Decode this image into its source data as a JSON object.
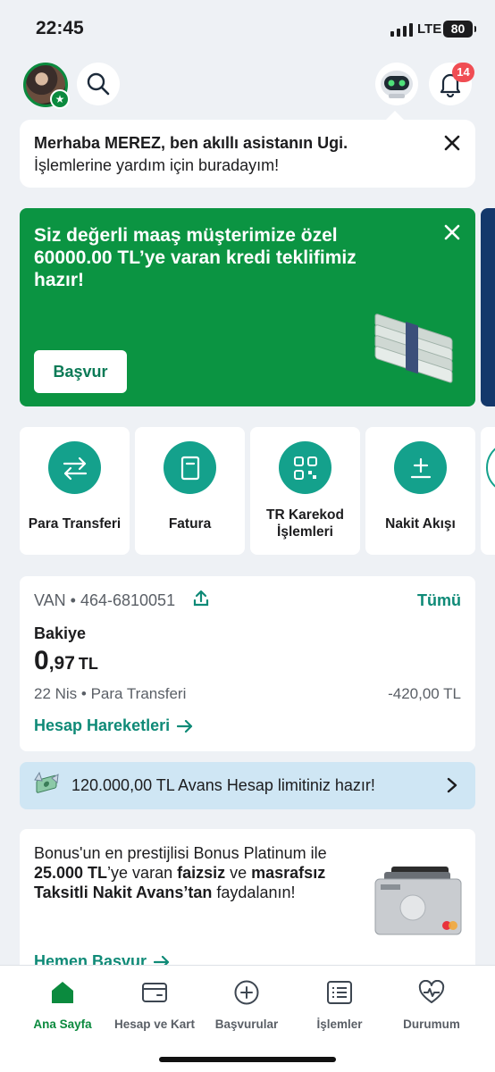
{
  "status_bar": {
    "time": "22:45",
    "network": "LTE",
    "battery": "80"
  },
  "header": {
    "notification_count": "14"
  },
  "assistant": {
    "line1": "Merhaba MEREZ, ben akıllı asistanın Ugi.",
    "line2": "İşlemlerine yardım için buradayım!"
  },
  "promo": {
    "title": "Siz değerli maaş müşterimize özel 60000.00 TL’ye varan kredi teklifimiz hazır!",
    "button": "Başvur"
  },
  "quick_actions": [
    {
      "label": "Para Transferi",
      "icon": "transfer-arrows-icon"
    },
    {
      "label": "Fatura",
      "icon": "bill-icon"
    },
    {
      "label": "TR Karekod İşlemleri",
      "icon": "qr-code-icon"
    },
    {
      "label": "Nakit Akışı",
      "icon": "cash-flow-icon"
    }
  ],
  "account": {
    "number": "VAN • 464-6810051",
    "all_link": "Tümü",
    "balance_label": "Bakiye",
    "balance_int": "0",
    "balance_dec": ",97",
    "balance_currency": "TL",
    "last_tx": "22 Nis • Para Transferi",
    "last_amount": "-420,00 TL",
    "movements_link": "Hesap Hareketleri"
  },
  "avans": {
    "text": "120.000,00 TL Avans Hesap limitiniz hazır!"
  },
  "bonus": {
    "t1": "Bonus'un en prestijlisi Bonus Platinum ile ",
    "t2": "25.000 TL",
    "t3": "’ye varan ",
    "t4": "faizsiz",
    "t5": " ve ",
    "t6": "masrafsız Taksitli Nakit Avans’tan",
    "t7": " faydalanın!",
    "apply_link": "Hemen Başvur"
  },
  "nav": [
    {
      "label": "Ana Sayfa",
      "active": true
    },
    {
      "label": "Hesap ve Kart"
    },
    {
      "label": "Başvurular"
    },
    {
      "label": "İşlemler"
    },
    {
      "label": "Durumum"
    }
  ],
  "colors": {
    "brand_green": "#0b9442",
    "teal": "#14a18c",
    "link": "#0f8a77",
    "badge_red": "#f04d53"
  }
}
